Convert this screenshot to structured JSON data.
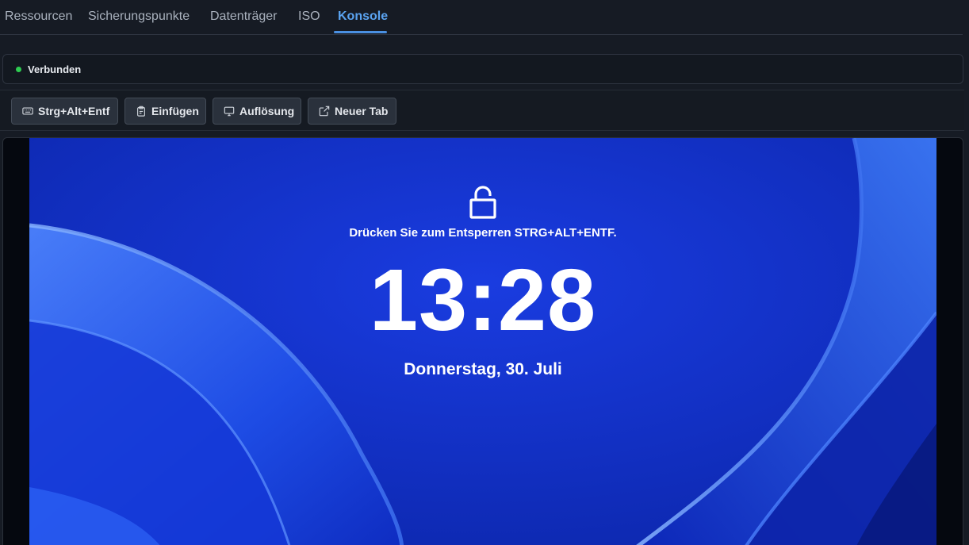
{
  "tabs": [
    {
      "label": "Ressourcen",
      "active": false
    },
    {
      "label": "Sicherungspunkte",
      "active": false
    },
    {
      "label": "Datenträger",
      "active": false
    },
    {
      "label": "ISO",
      "active": false
    },
    {
      "label": "Konsole",
      "active": true
    }
  ],
  "status": {
    "label": "Verbunden",
    "color": "#2ecc51"
  },
  "toolbar": {
    "ctrl_alt_del": {
      "label": "Strg+Alt+Entf",
      "icon": "keyboard-icon"
    },
    "paste": {
      "label": "Einfügen",
      "icon": "clipboard-icon"
    },
    "resolution": {
      "label": "Auflösung",
      "icon": "monitor-icon"
    },
    "new_tab": {
      "label": "Neuer Tab",
      "icon": "external-link-icon"
    }
  },
  "lockscreen": {
    "icon": "unlock-icon",
    "hint": "Drücken Sie zum Entsperren STRG+ALT+ENTF.",
    "time": "13:28",
    "date": "Donnerstag, 30. Juli"
  },
  "colors": {
    "accent": "#4a90e2",
    "wallpaper_base": "#1135d2"
  }
}
